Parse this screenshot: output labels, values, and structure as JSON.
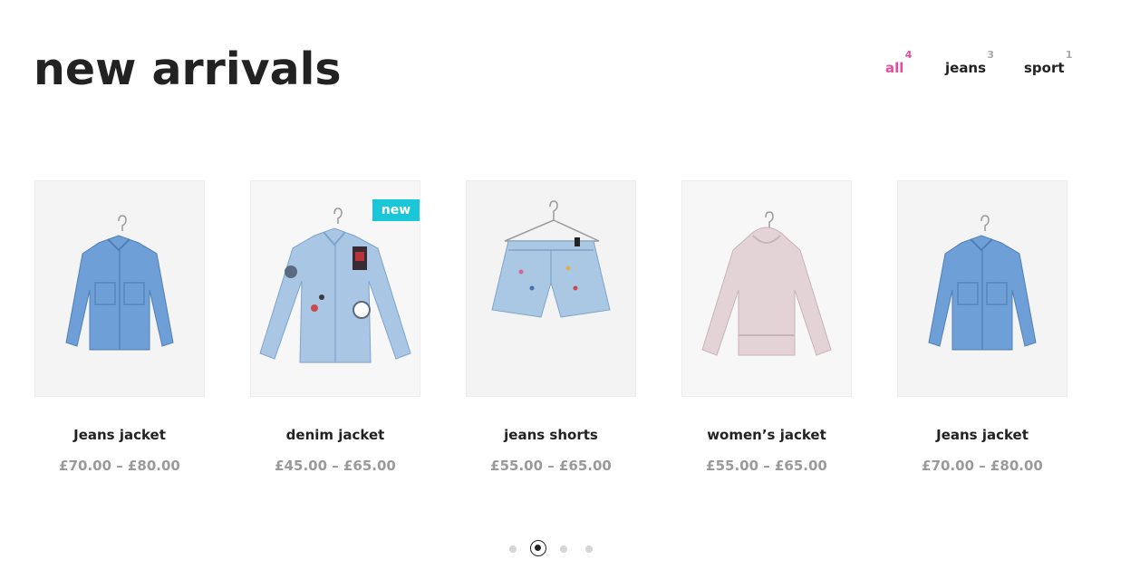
{
  "header": {
    "title": "new arrivals"
  },
  "filters": [
    {
      "label": "all",
      "count": "4",
      "active": true
    },
    {
      "label": "jeans",
      "count": "3",
      "active": false
    },
    {
      "label": "sport",
      "count": "1",
      "active": false
    }
  ],
  "products": [
    {
      "name": "Jeans jacket",
      "price": "£70.00 – £80.00",
      "image": "jeans-jacket-image",
      "badge": ""
    },
    {
      "name": "denim jacket",
      "price": "£45.00 – £65.00",
      "image": "denim-jacket-image",
      "badge": "new"
    },
    {
      "name": "jeans shorts",
      "price": "£55.00 – £65.00",
      "image": "jeans-shorts-image",
      "badge": ""
    },
    {
      "name": "women’s jacket",
      "price": "£55.00 – £65.00",
      "image": "womens-jacket-image",
      "badge": ""
    },
    {
      "name": "Jeans jacket",
      "price": "£70.00 – £80.00",
      "image": "jeans-jacket-image",
      "badge": ""
    }
  ],
  "pager": {
    "page_count": 4,
    "active_page": 2
  },
  "colors": {
    "accent_pink": "#e84c9c",
    "badge_cyan": "#19c7d8",
    "price_gray": "#9a9a9a"
  }
}
